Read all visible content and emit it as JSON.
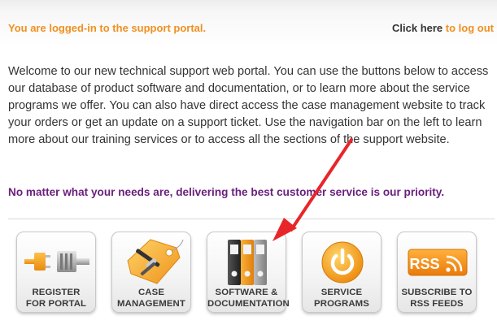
{
  "header": {
    "status_text": "You are logged-in to the support portal.",
    "logout_prefix": "Click here",
    "logout_link": "to log out"
  },
  "welcome_text": "Welcome to our new technical support web portal. You can use the buttons below to access our database of product software and documentation, or to learn more about the service programs we offer. You can also have direct access the case management website to track your orders or get an update on a support ticket. Use the navigation bar on the left to learn more about our training services or to access all the sections of the support website.",
  "priority_text": "No matter what your needs are, delivering the best customer service is our priority.",
  "tiles": [
    {
      "icon": "plug-icon",
      "line1": "REGISTER",
      "line2": "FOR PORTAL"
    },
    {
      "icon": "tools-tag-icon",
      "line1": "CASE",
      "line2": "MANAGEMENT"
    },
    {
      "icon": "binders-icon",
      "line1": "SOFTWARE &",
      "line2": "DOCUMENTATION"
    },
    {
      "icon": "power-icon",
      "line1": "SERVICE",
      "line2": "PROGRAMS"
    },
    {
      "icon": "rss-icon",
      "line1": "SUBSCRIBE TO",
      "line2": "RSS FEEDS",
      "badge": "RSS"
    }
  ],
  "colors": {
    "accent_orange": "#f0901e",
    "priority_purple": "#6a1f7c",
    "annotation_arrow": "#e8262a"
  }
}
